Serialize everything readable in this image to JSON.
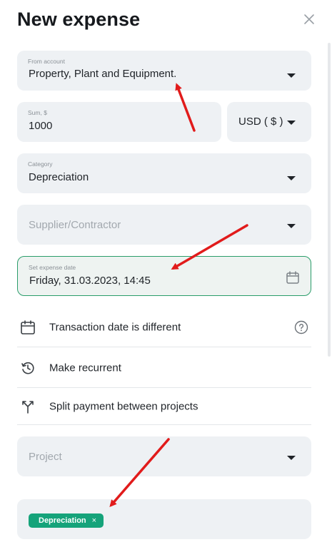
{
  "header": {
    "title": "New expense"
  },
  "from_account": {
    "label": "From account",
    "value": "Property, Plant and Equipment."
  },
  "sum": {
    "label": "Sum, $",
    "value": "1000"
  },
  "currency": {
    "value": "USD ( $ )"
  },
  "category": {
    "label": "Category",
    "value": "Depreciation"
  },
  "supplier": {
    "placeholder": "Supplier/Contractor"
  },
  "expense_date": {
    "label": "Set expense date",
    "value": "Friday, 31.03.2023, 14:45"
  },
  "options": {
    "transaction_date": "Transaction date is different",
    "recurrent": "Make recurrent",
    "split": "Split payment between projects"
  },
  "project": {
    "placeholder": "Project"
  },
  "tags": [
    {
      "label": "Depreciation",
      "remove": "×"
    }
  ],
  "colors": {
    "accent": "#15a37a",
    "active_border": "#2a9d6a",
    "annotation": "#e11b1b",
    "field_bg": "#eef1f4"
  },
  "icons": [
    "close-icon",
    "calendar-icon",
    "history-icon",
    "split-icon",
    "help-icon",
    "chevron-down-icon"
  ]
}
